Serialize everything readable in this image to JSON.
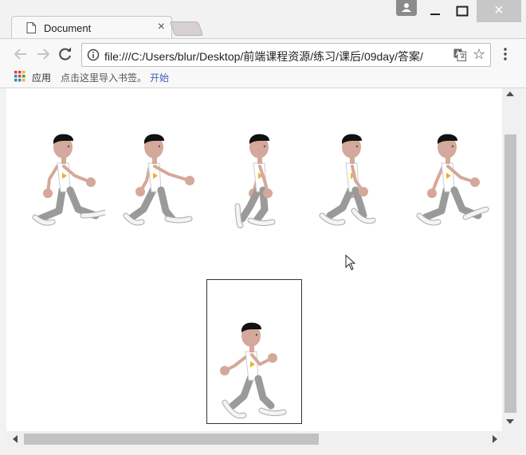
{
  "tab": {
    "title": "Document",
    "close_glyph": "×"
  },
  "window_controls": {
    "user": "user-icon",
    "minimize": "minimize-icon",
    "maximize": "maximize-icon",
    "close": "×"
  },
  "toolbar": {
    "url": "file:///C:/Users/blur/Desktop/前端课程资源/练习/课后/09day/答案/",
    "star_glyph": "☆"
  },
  "bookmarks": {
    "apps_label": "应用",
    "import_text": "点击这里导入书签。",
    "start_link": "开始"
  },
  "colors": {
    "hair": "#111111",
    "skin": "#d4a89a",
    "shirt": "#ffffff",
    "accent": "#f0b030",
    "pants": "#9a9a9a",
    "shoe": "#f4f4f4"
  },
  "page": {
    "walk_frames": [
      1,
      2,
      3,
      4,
      5
    ],
    "preview_frame": 6
  }
}
